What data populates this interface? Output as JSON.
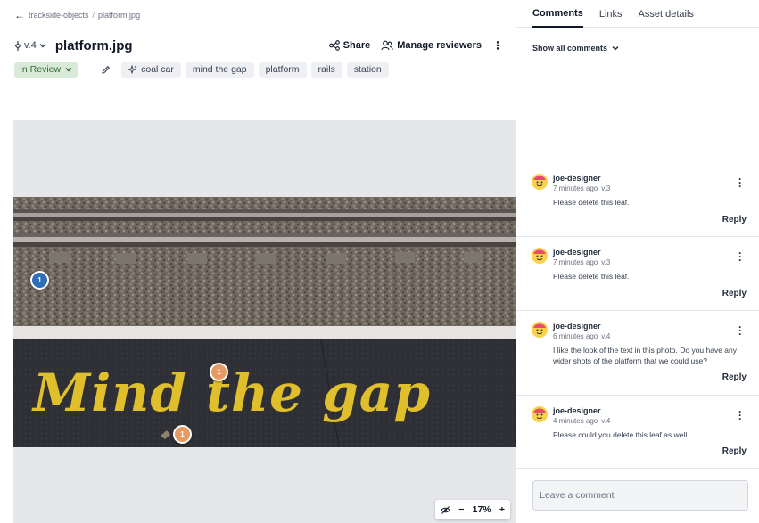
{
  "breadcrumb": {
    "project": "trackside-objects",
    "separator": "/",
    "file": "platform.jpg"
  },
  "header": {
    "version": "v.4",
    "filename": "platform.jpg",
    "share_label": "Share",
    "manage_label": "Manage reviewers"
  },
  "status": {
    "label": "In Review",
    "color": "#d9ead8"
  },
  "tags": [
    {
      "label": "coal car",
      "ai": true
    },
    {
      "label": "mind the gap"
    },
    {
      "label": "platform"
    },
    {
      "label": "rails"
    },
    {
      "label": "station"
    }
  ],
  "pins": [
    {
      "label": "1",
      "color": "blue"
    },
    {
      "label": "1",
      "color": "orange"
    },
    {
      "label": "1",
      "color": "orange"
    }
  ],
  "photo_text": "Mind the gap",
  "zoom": {
    "minus": "−",
    "level": "17%",
    "plus": "+"
  },
  "tabs": [
    "Comments",
    "Links",
    "Asset details"
  ],
  "show_all": "Show all comments",
  "comments": [
    {
      "author": "joe-designer",
      "time": "7 minutes ago",
      "version": "v.3",
      "text": "Please delete this leaf.",
      "reply": "Reply"
    },
    {
      "author": "joe-designer",
      "time": "7 minutes ago",
      "version": "v.3",
      "text": "Please delete this leaf.",
      "reply": "Reply"
    },
    {
      "author": "joe-designer",
      "time": "6 minutes ago",
      "version": "v.4",
      "text": "I like the look of the text in this photo. Do you have any wider shots of the platform that we could use?",
      "reply": "Reply"
    },
    {
      "author": "joe-designer",
      "time": "4 minutes ago",
      "version": "v.4",
      "text": "Please could you delete this leaf as well.",
      "reply": "Reply"
    }
  ],
  "composer": {
    "placeholder": "Leave a comment"
  },
  "colors": {
    "accent": "#111827",
    "pin_blue": "#2f6fb7",
    "pin_orange": "#e49a62",
    "tag_bg": "#eef0f3",
    "status_text": "#2f6b33"
  }
}
